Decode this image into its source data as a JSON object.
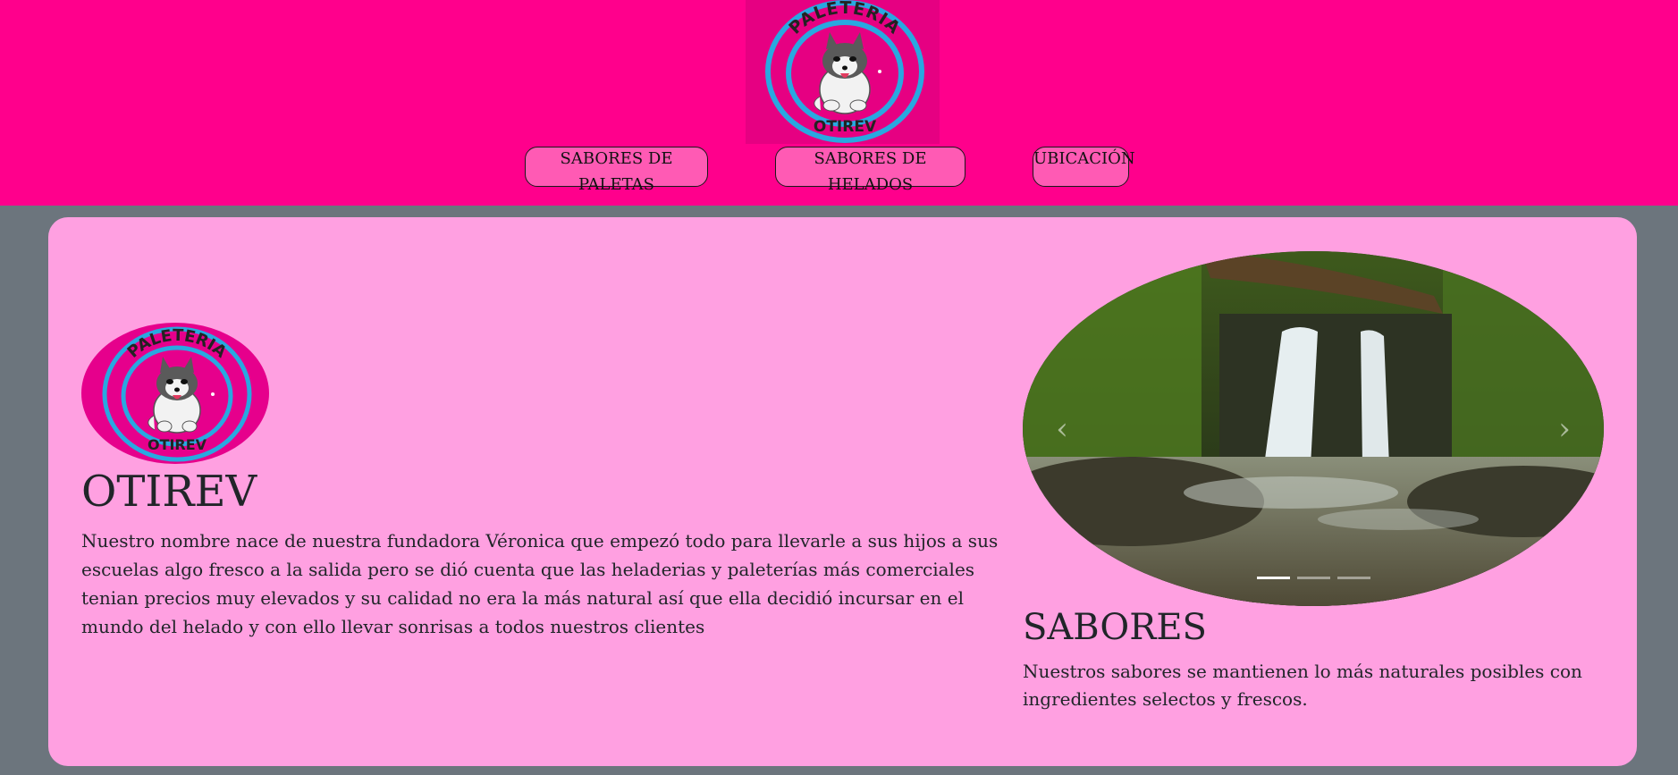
{
  "header": {
    "logo": {
      "top_text": "PALETERIA",
      "bottom_text": "OTIREV",
      "alt": "husky-logo"
    },
    "nav": [
      {
        "label": "SABORES DE PALETAS"
      },
      {
        "label": "SABORES DE HELADOS"
      },
      {
        "label": "UBICACIÓN"
      }
    ]
  },
  "about": {
    "title": "OTIREV",
    "text": "Nuestro nombre nace de nuestra fundadora Véronica que empezó todo para llevarle a sus hijos a sus escuelas algo fresco a la salida pero se dió cuenta que las heladerias y paleterías más comerciales tenian precios muy elevados y su calidad no era la más natural así que ella decidió incursar en el mundo del helado y con ello llevar sonrisas a todos nuestros clientes"
  },
  "carousel": {
    "image": "waterfall-forest-photo",
    "prev_icon": "chevron-left-icon",
    "next_icon": "chevron-right-icon",
    "slides": 3,
    "active_slide": 1
  },
  "flavors": {
    "title": "SABORES",
    "text": "Nuestros sabores se mantienen lo más naturales posibles con ingredientes selectos y frescos."
  },
  "colors": {
    "header_bg": "#ff008c",
    "card_bg": "#ffa0e1",
    "page_bg": "#6c757d",
    "nav_button_bg": "#ff5ab4",
    "logo_ring": "#29a8e0"
  }
}
